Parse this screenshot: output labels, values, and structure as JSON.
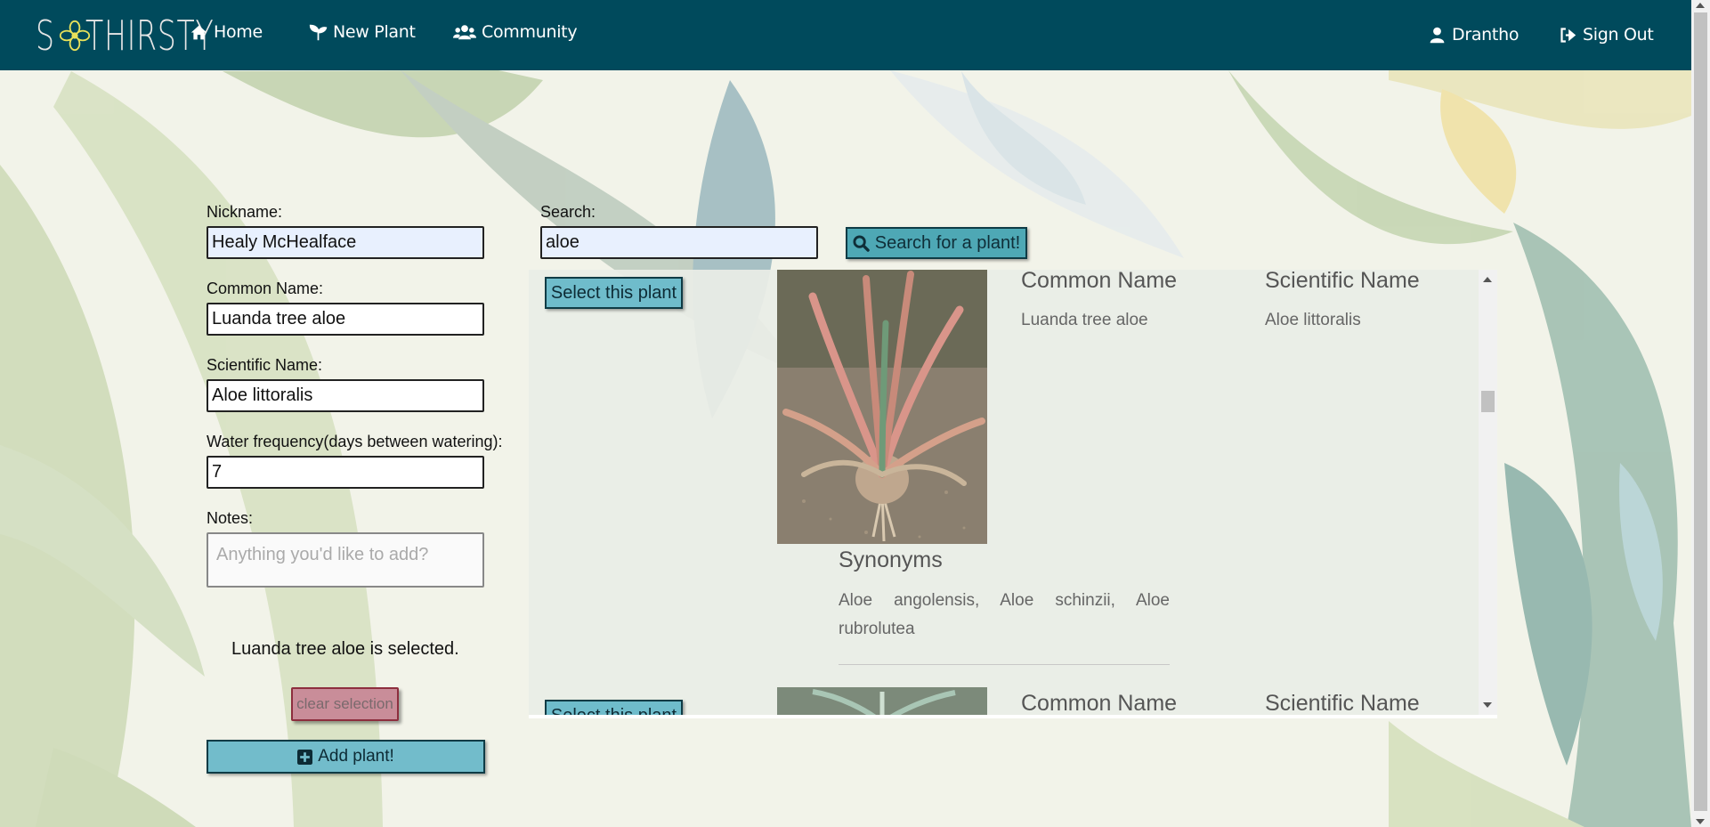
{
  "brand": {
    "logo_text_left": "S",
    "logo_text_right": "THIRSTY",
    "flower_icon": "flower-icon"
  },
  "nav": {
    "home": "Home",
    "new_plant": "New Plant",
    "community": "Community",
    "user": "Drantho",
    "sign_out": "Sign Out"
  },
  "form": {
    "nickname_label": "Nickname:",
    "nickname_value": "Healy McHealface",
    "common_label": "Common Name:",
    "common_value": "Luanda tree aloe",
    "scientific_label": "Scientific Name:",
    "scientific_value": "Aloe littoralis",
    "water_label": "Water frequency(days between watering):",
    "water_value": "7",
    "notes_label": "Notes:",
    "notes_placeholder": "Anything you'd like to add?",
    "selected_message": "Luanda tree aloe is selected.",
    "clear_label": "clear selection",
    "add_label": "Add plant!"
  },
  "search": {
    "label": "Search:",
    "value": "aloe",
    "button_label": "Search for a plant!"
  },
  "results": [
    {
      "select_label": "Select this plant",
      "common_head": "Common Name",
      "common_value": "Luanda tree aloe",
      "scientific_head": "Scientific Name",
      "scientific_value": "Aloe littoralis",
      "synonyms_head": "Synonyms",
      "synonyms_value": "Aloe angolensis, Aloe schinzii, Aloe rubrolutea"
    },
    {
      "select_label": "Select this plant",
      "common_head": "Common Name",
      "scientific_head": "Scientific Name"
    }
  ],
  "colors": {
    "navbar": "#004a5c",
    "button_teal": "#6fbccb",
    "clear_button": "#c98d99"
  }
}
